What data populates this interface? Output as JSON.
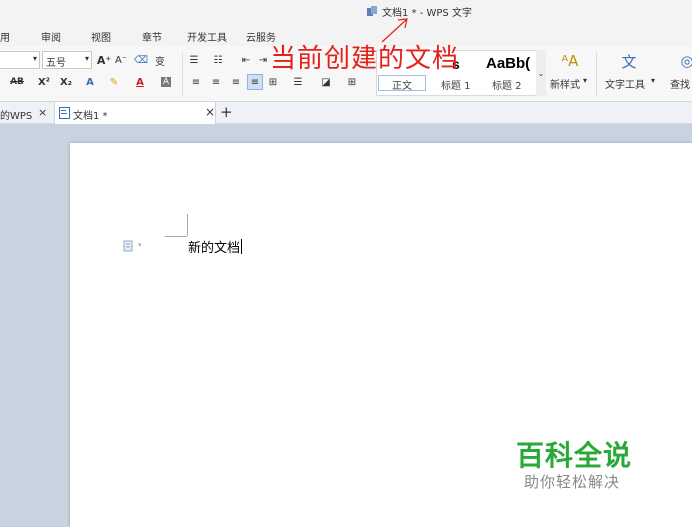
{
  "window": {
    "title": "文档1 * - WPS 文字"
  },
  "menu": {
    "tabs": [
      "用",
      "审阅",
      "视图",
      "章节",
      "开发工具",
      "云服务"
    ]
  },
  "ribbon": {
    "font_size": "五号",
    "grow_font_label": "A⁺",
    "shrink_font_label": "A⁻",
    "phonetic_label": "变",
    "strikethrough_label": "AB",
    "superscript_label": "X²",
    "subscript_label": "X₂",
    "styles": {
      "sample_big": "AaBb(",
      "sample_partial": "s",
      "normal_label": "正文",
      "heading1_label": "标题 1",
      "heading2_label": "标题 2"
    },
    "new_style_label": "新样式",
    "text_tools_label": "文字工具",
    "find_label": "查找"
  },
  "annotation": {
    "text": "当前创建的文档"
  },
  "doc_tabs": [
    {
      "label": "的WPS"
    },
    {
      "label": "文档1 *"
    }
  ],
  "document": {
    "body_text": "新的文档"
  },
  "watermark": {
    "title": "百科全说",
    "subtitle": "助你轻松解决"
  },
  "colors": {
    "annotation": "#e4211b",
    "watermark_green": "#2aa838",
    "canvas": "#c9d3df"
  }
}
